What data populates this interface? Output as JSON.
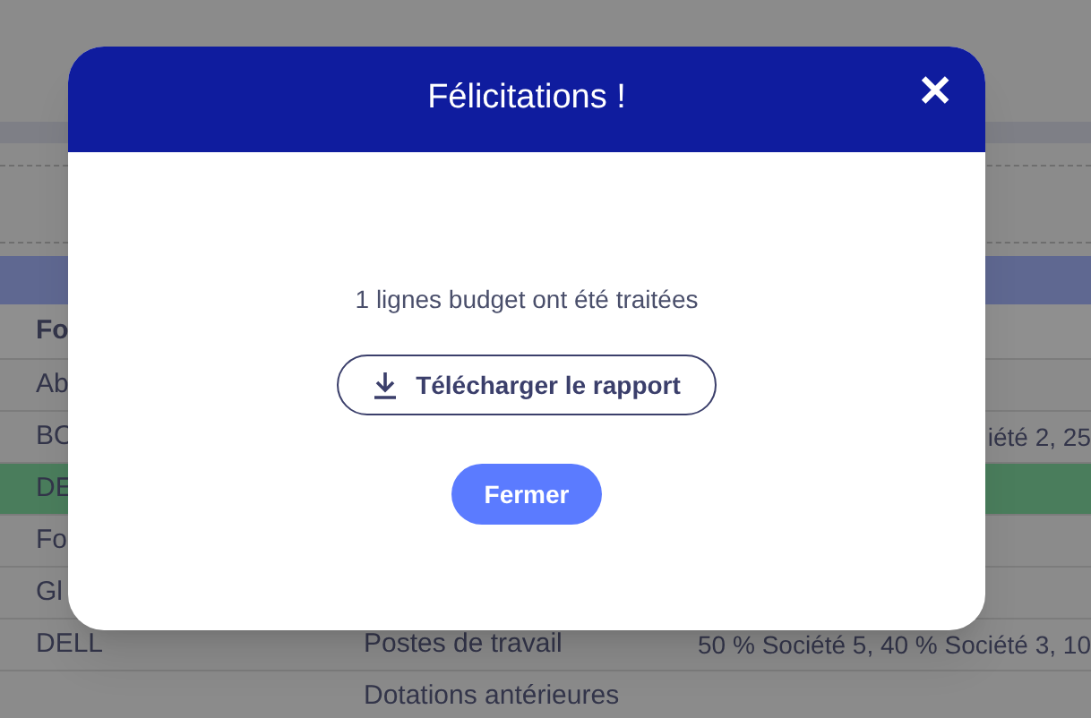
{
  "table": {
    "header": [
      "Fo"
    ],
    "rows": [
      {
        "cells": [
          "Ab",
          "",
          ""
        ],
        "selected": false
      },
      {
        "cells": [
          "BO",
          "",
          "iété 2, 25"
        ],
        "selected": false
      },
      {
        "cells": [
          "DE",
          "",
          ""
        ],
        "selected": true
      },
      {
        "cells": [
          "Fo",
          "",
          ""
        ],
        "selected": false
      },
      {
        "cells": [
          "Gl",
          "",
          ""
        ],
        "selected": false
      },
      {
        "cells": [
          "DELL",
          "Postes de travail",
          "50 % Société 5, 40 % Société 3, 10"
        ],
        "selected": false
      },
      {
        "cells": [
          "",
          "Dotations antérieures",
          ""
        ],
        "selected": false
      }
    ]
  },
  "modal": {
    "title": "Félicitations !",
    "close_icon": "✕",
    "message": "1 lignes budget ont été traitées",
    "download_button": "Télécharger le rapport",
    "close_button": "Fermer"
  }
}
